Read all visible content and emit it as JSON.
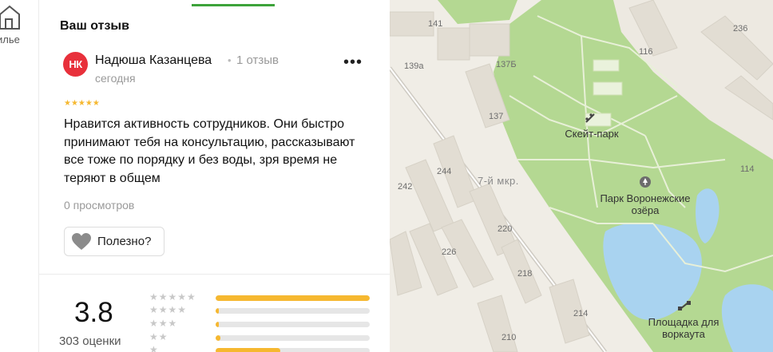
{
  "sidebar": {
    "nav_label": "илье"
  },
  "review_section": {
    "title": "Ваш отзыв",
    "author": {
      "initials": "НК",
      "name": "Надюша Казанцева",
      "separator": "•",
      "reviews_count": "1 отзыв",
      "date": "сегодня",
      "avatar_color": "#e8303b"
    },
    "more_label": "•••",
    "rating_stars": "★★★★★",
    "text": "Нравится активность сотрудников. Они быстро принимают тебя на консультацию, рассказывают все тоже по порядку и без воды, зря время не теряют в общем",
    "views": "0 просмотров",
    "helpful_label": "Полезно?"
  },
  "rating_summary": {
    "average": "3.8",
    "count_label": "303 оценки",
    "distribution": [
      {
        "stars": "★★★★★",
        "fraction": 1.0
      },
      {
        "stars": "★★★★",
        "fraction": 0.02
      },
      {
        "stars": "★★★",
        "fraction": 0.02
      },
      {
        "stars": "★★",
        "fraction": 0.03
      },
      {
        "stars": "★",
        "fraction": 0.42
      }
    ],
    "bar_color": "#f6b830"
  },
  "map": {
    "building_labels": [
      "141",
      "139а",
      "137Б",
      "137",
      "116",
      "236",
      "114",
      "244",
      "242",
      "220",
      "226",
      "218",
      "214",
      "210"
    ],
    "district_label": "7-й мкр.",
    "pois": [
      {
        "name": "Скейт-парк",
        "icon": "skateboard-icon"
      },
      {
        "name": "Парк Воронежские озёра",
        "icon": "park-pin-icon"
      },
      {
        "name": "Площадка для воркаута",
        "icon": "dumbbell-icon"
      }
    ],
    "colors": {
      "park": "#b4d892",
      "water": "#a9d3f0",
      "ground": "#f0ede6",
      "building": "#e2ddd3"
    }
  }
}
